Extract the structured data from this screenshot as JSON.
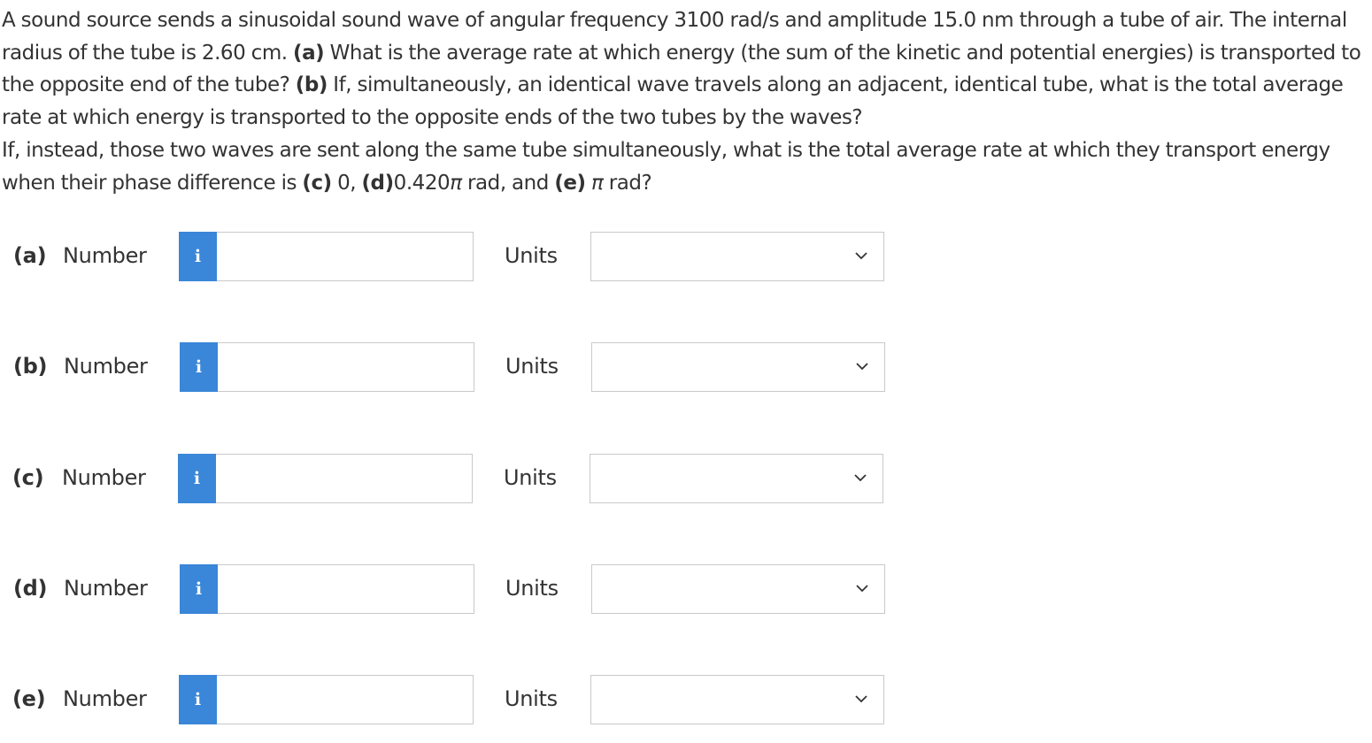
{
  "question": {
    "p1_t1": "A sound source sends a sinusoidal sound wave of angular frequency 3100 rad/s and amplitude 15.0 nm through a tube of air. The internal radius of the tube is 2.60 cm. ",
    "p1_a": "(a)",
    "p1_t2": " What is the average rate at which energy (the sum of the kinetic and potential energies) is transported to the opposite end of the tube? ",
    "p1_b": "(b)",
    "p1_t3": " If, simultaneously, an identical wave travels along an adjacent, identical tube, what is the total average rate at which energy is transported to the opposite ends of the two tubes by the waves?",
    "p2_t1": "If, instead, those two waves are sent along the same tube simultaneously, what is the total average rate at which they transport energy when their phase difference is ",
    "p2_c": "(c)",
    "p2_t2": " 0, ",
    "p2_d": "(d)",
    "p2_t3": "0.420",
    "p2_pi1": "π",
    "p2_t4": " rad, and ",
    "p2_e": "(e)",
    "p2_t5": " ",
    "p2_pi2": "π",
    "p2_t6": " rad?"
  },
  "rows": [
    {
      "part": "(a)",
      "number_label": "Number",
      "info_icon": "i",
      "number_value": "",
      "units_label": "Units",
      "units_value": ""
    },
    {
      "part": "(b)",
      "number_label": "Number",
      "info_icon": "i",
      "number_value": "",
      "units_label": "Units",
      "units_value": ""
    },
    {
      "part": "(c)",
      "number_label": "Number",
      "info_icon": "i",
      "number_value": "",
      "units_label": "Units",
      "units_value": ""
    },
    {
      "part": "(d)",
      "number_label": "Number",
      "info_icon": "i",
      "number_value": "",
      "units_label": "Units",
      "units_value": ""
    },
    {
      "part": "(e)",
      "number_label": "Number",
      "info_icon": "i",
      "number_value": "",
      "units_label": "Units",
      "units_value": ""
    }
  ],
  "colors": {
    "info_button": "#3a86d8",
    "border": "#c9c9c9",
    "text": "#333333"
  },
  "icons": {
    "info": "info-icon",
    "dropdown": "chevron-down-icon"
  }
}
